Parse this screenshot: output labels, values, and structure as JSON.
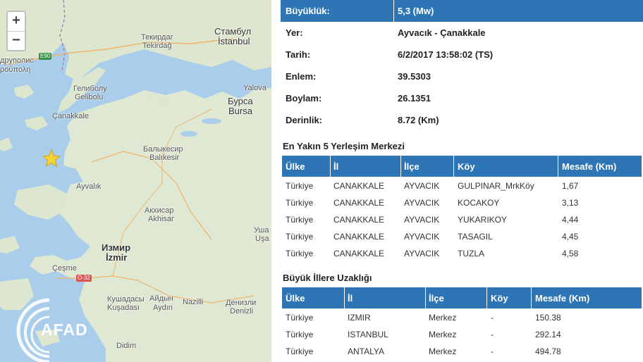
{
  "map": {
    "zoom_in": "+",
    "zoom_out": "−",
    "logo_text": "AFAD",
    "labels": {
      "istanbul_cyr": "Стамбул",
      "istanbul": "İstanbul",
      "tekirdag_cyr": "Текирдаг",
      "tekirdag": "Tekirdağ",
      "gelibolu_cyr": "Гелиболу",
      "gelibolu": "Gelibolu",
      "canakkale": "Çanakkale",
      "yalova": "Yalova",
      "bursa_cyr": "Бурса",
      "bursa": "Bursa",
      "balikesir_cyr": "Балыкесир",
      "balikesir": "Balıkesir",
      "ayvalik": "Ayvalık",
      "akhisar_cyr": "Акхисар",
      "akhisar": "Akhisar",
      "usak_cyr": "Уша",
      "usak": "Uşa",
      "izmir_cyr": "Измир",
      "izmir": "İzmir",
      "cesme": "Çeşme",
      "kusadasi_cyr": "Кушадасы",
      "kusadasi": "Kuşadası",
      "aydin_cyr": "Айдын",
      "aydin": "Aydın",
      "nazilli": "Nazilli",
      "denizli_cyr": "Денизли",
      "denizli": "Denizli",
      "didim": "Didim",
      "alexandroupoli": "дрyполис",
      "alexandroupoli2": "ρούπολη",
      "e90": "E90",
      "o32": "O-32"
    }
  },
  "info": [
    {
      "key": "Büyüklük:",
      "value": "5,3 (Mw)"
    },
    {
      "key": "Yer:",
      "value": "Ayvacık - Çanakkale"
    },
    {
      "key": "Tarih:",
      "value": "6/2/2017 13:58:02 (TS)"
    },
    {
      "key": "Enlem:",
      "value": "39.5303"
    },
    {
      "key": "Boylam:",
      "value": "26.1351"
    },
    {
      "key": "Derinlik:",
      "value": "8.72 (Km)"
    }
  ],
  "nearest": {
    "title": "En Yakın 5 Yerleşim Merkezi",
    "headers": [
      "Ülke",
      "İl",
      "İlçe",
      "Köy",
      "Mesafe (Km)"
    ],
    "rows": [
      [
        "Türkiye",
        "CANAKKALE",
        "AYVACIK",
        "GULPINAR_MrkKöy",
        "1,67"
      ],
      [
        "Türkiye",
        "CANAKKALE",
        "AYVACIK",
        "KOCAKOY",
        "3,13"
      ],
      [
        "Türkiye",
        "CANAKKALE",
        "AYVACIK",
        "YUKARIKOY",
        "4,44"
      ],
      [
        "Türkiye",
        "CANAKKALE",
        "AYVACIK",
        "TASAGIL",
        "4,45"
      ],
      [
        "Türkiye",
        "CANAKKALE",
        "AYVACIK",
        "TUZLA",
        "4,58"
      ]
    ]
  },
  "cities": {
    "title": "Büyük İllere Uzaklığı",
    "headers": [
      "Ülke",
      "İl",
      "İlçe",
      "Köy",
      "Mesafe (Km)"
    ],
    "rows": [
      [
        "Türkiye",
        "IZMIR",
        "Merkez",
        "-",
        "150.38"
      ],
      [
        "Türkiye",
        "ISTANBUL",
        "Merkez",
        "-",
        "292.14"
      ],
      [
        "Türkiye",
        "ANTALYA",
        "Merkez",
        "-",
        "494.78"
      ]
    ]
  },
  "colors": {
    "header_blue": "#2e75b6",
    "sea": "#a9cdea",
    "land": "#dfe8d2",
    "star": "#f5d33b"
  }
}
